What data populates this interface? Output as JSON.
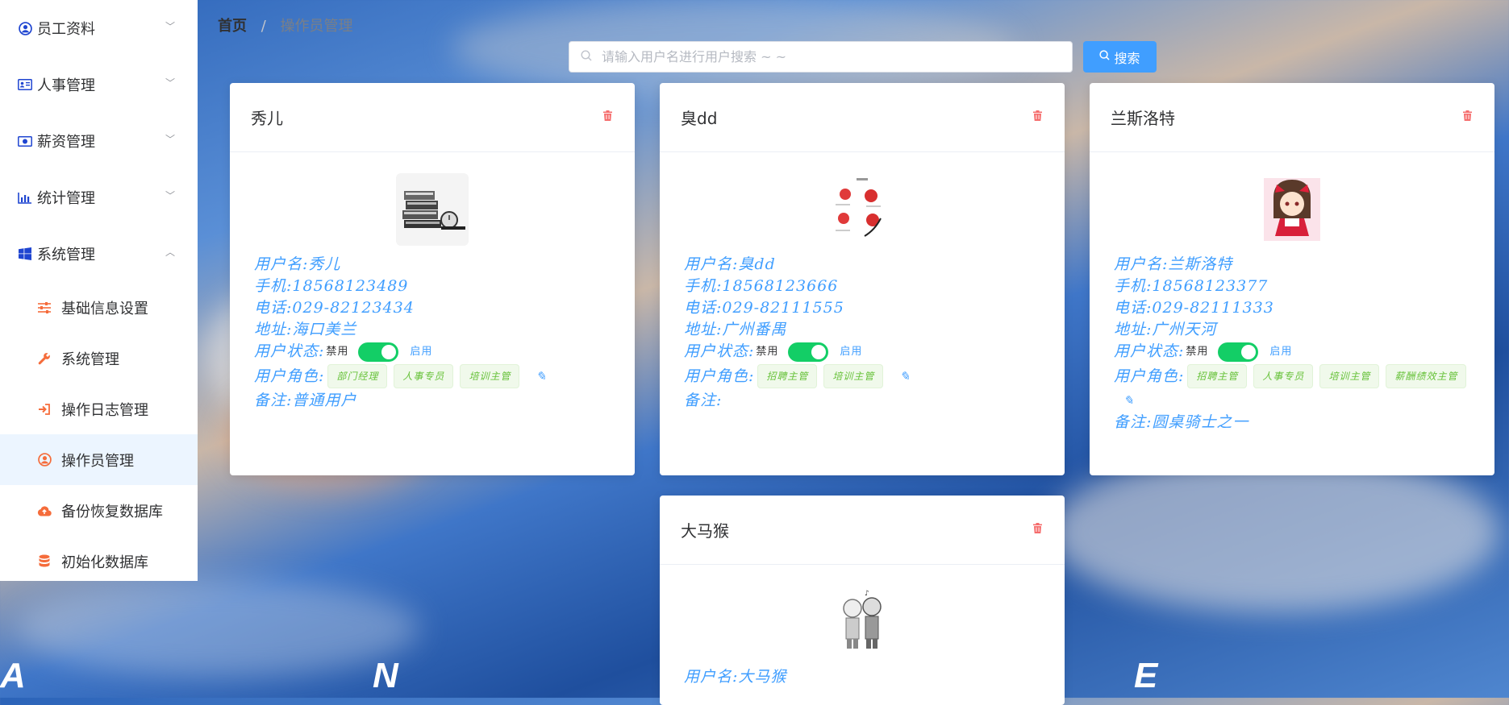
{
  "sidebar": {
    "menus": [
      {
        "label": "员工资料",
        "icon": "user-circle-icon",
        "expanded": false
      },
      {
        "label": "人事管理",
        "icon": "id-card-icon",
        "expanded": false
      },
      {
        "label": "薪资管理",
        "icon": "money-icon",
        "expanded": false
      },
      {
        "label": "统计管理",
        "icon": "bar-chart-icon",
        "expanded": false
      },
      {
        "label": "系统管理",
        "icon": "windows-icon",
        "expanded": true
      }
    ],
    "submenu": [
      {
        "label": "基础信息设置",
        "icon": "sliders-icon"
      },
      {
        "label": "系统管理",
        "icon": "wrench-icon"
      },
      {
        "label": "操作日志管理",
        "icon": "sign-in-icon"
      },
      {
        "label": "操作员管理",
        "icon": "user-circle-icon",
        "active": true
      },
      {
        "label": "备份恢复数据库",
        "icon": "cloud-upload-icon"
      },
      {
        "label": "初始化数据库",
        "icon": "database-icon"
      }
    ]
  },
  "breadcrumb": {
    "home": "首页",
    "separator": "/",
    "current": "操作员管理"
  },
  "search": {
    "placeholder": "请输入用户名进行用户搜索 ~ ~",
    "value": "",
    "button_label": "搜索"
  },
  "labels": {
    "username": "用户名:",
    "phone": "手机:",
    "tel": "电话:",
    "address": "地址:",
    "status": "用户状态:",
    "disabled": "禁用",
    "enabled": "启用",
    "roles": "用户角色:",
    "remark": "备注:"
  },
  "colors": {
    "accent": "#409eff",
    "switch_on": "#13ce66",
    "delete": "#f56c6c",
    "tag_text": "#67c23a"
  },
  "cards": [
    {
      "name": "秀儿",
      "username": "秀儿",
      "phone": "18568123489",
      "tel": "029-82123434",
      "address": "海口美兰",
      "enabled": true,
      "roles": [
        "部门经理",
        "人事专员",
        "培训主管"
      ],
      "remark": "普通用户"
    },
    {
      "name": "臭dd",
      "username": "臭dd",
      "phone": "18568123666",
      "tel": "029-82111555",
      "address": "广州番禺",
      "enabled": true,
      "roles": [
        "招聘主管",
        "培训主管"
      ],
      "remark": ""
    },
    {
      "name": "兰斯洛特",
      "username": "兰斯洛特",
      "phone": "18568123377",
      "tel": "029-82111333",
      "address": "广州天河",
      "enabled": true,
      "roles": [
        "招聘主管",
        "人事专员",
        "培训主管",
        "薪酬绩效主管"
      ],
      "remark": "圆桌骑士之一"
    },
    {
      "name": "大马猴",
      "username": "大马猴"
    }
  ],
  "decor_letters": [
    "A",
    "N",
    "E"
  ]
}
